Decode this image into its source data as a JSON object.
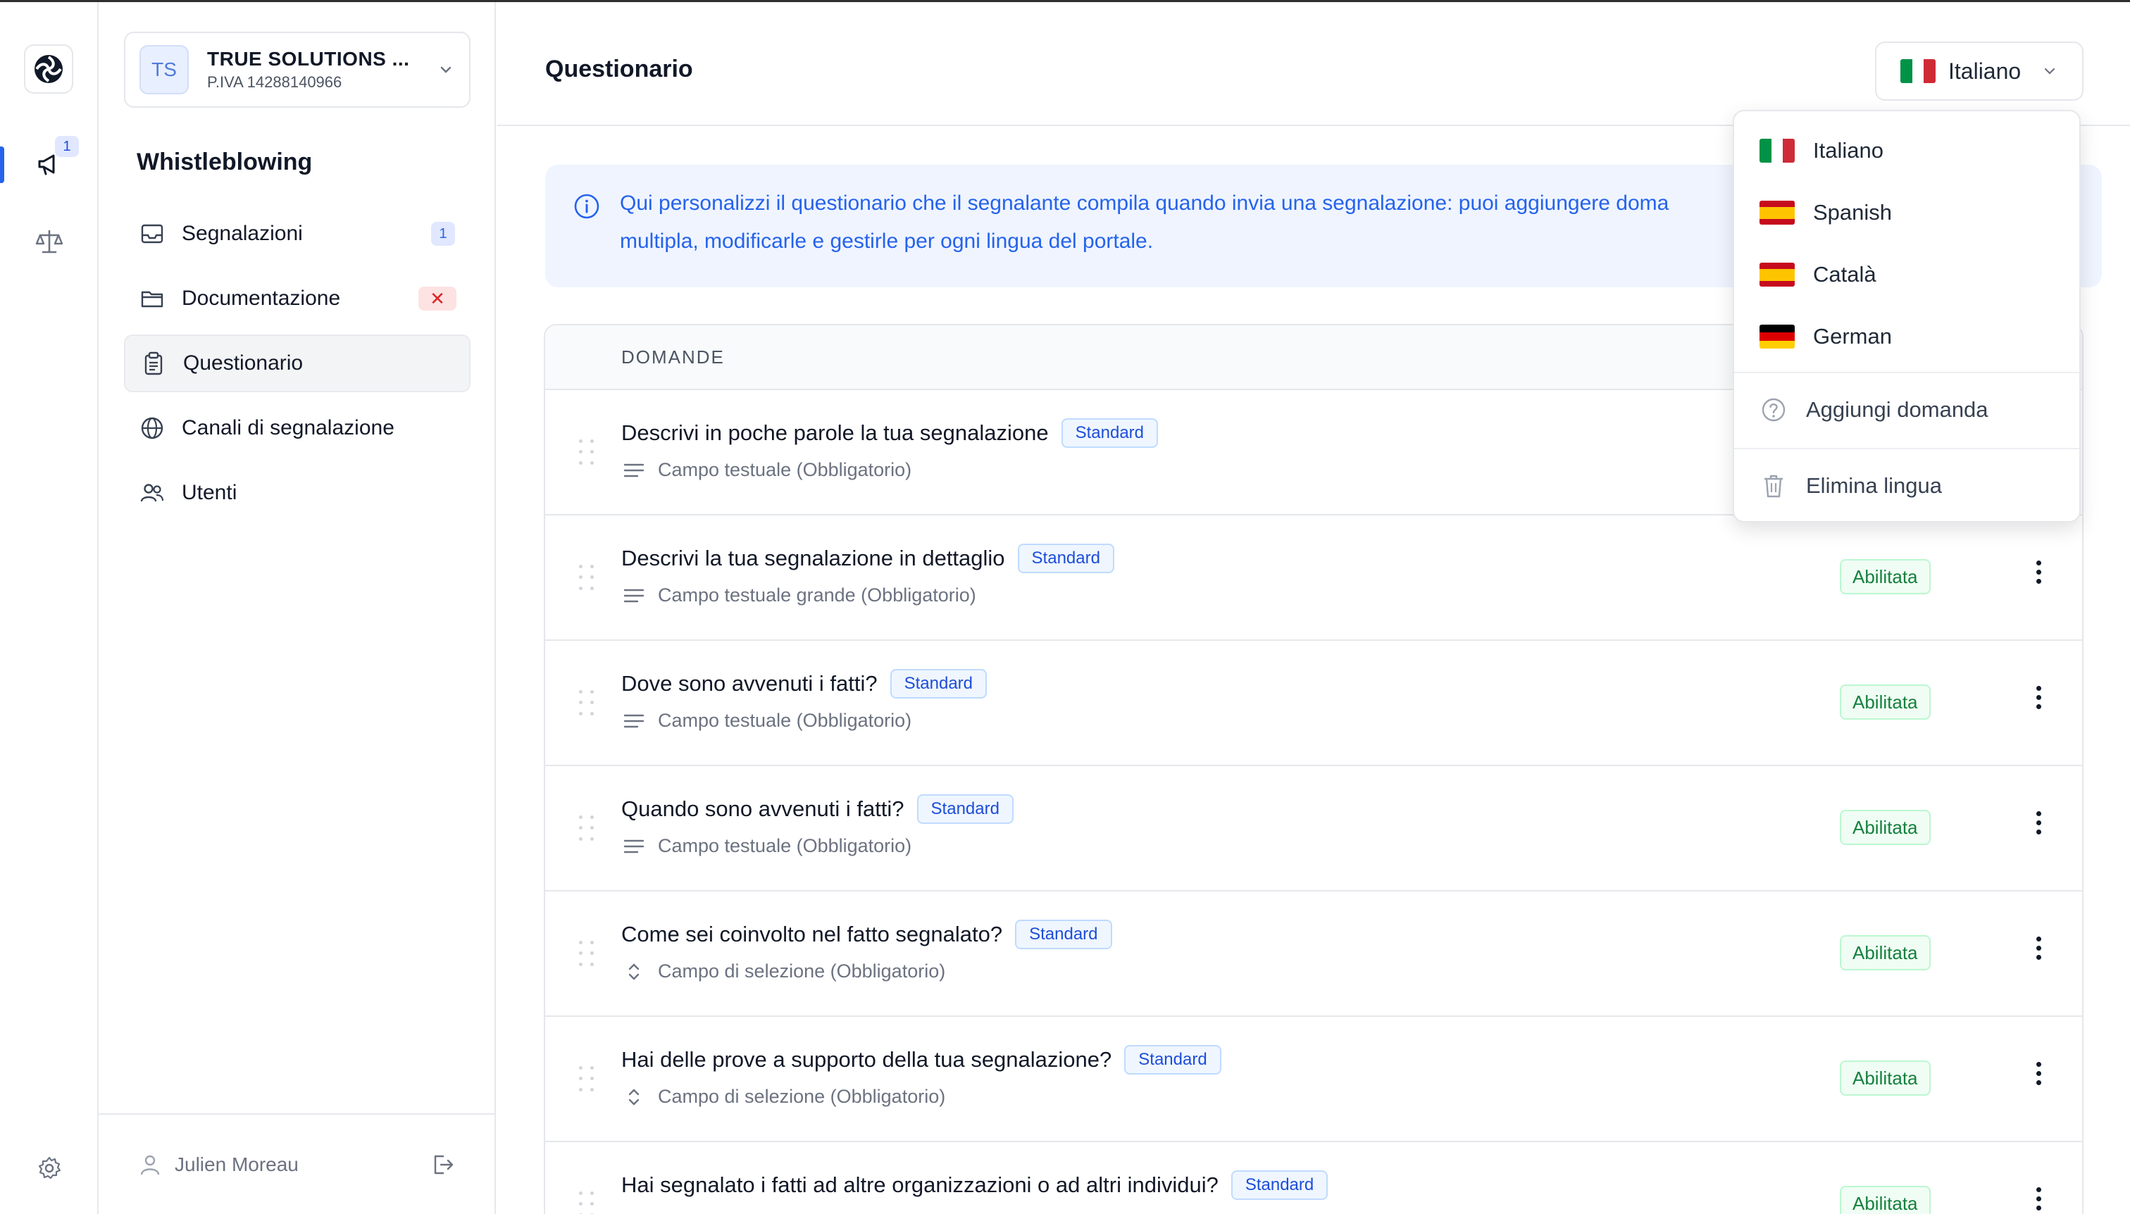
{
  "rail": {
    "badge": "1"
  },
  "org": {
    "initials": "TS",
    "name": "TRUE SOLUTIONS ...",
    "vat": "P.IVA 14288140966"
  },
  "sidebar": {
    "section_title": "Whistleblowing",
    "items": [
      {
        "label": "Segnalazioni",
        "icon": "inbox-icon",
        "badge": "1"
      },
      {
        "label": "Documentazione",
        "icon": "folder-icon",
        "badge": "✕"
      },
      {
        "label": "Questionario",
        "icon": "clipboard-icon",
        "active": true
      },
      {
        "label": "Canali di segnalazione",
        "icon": "globe-icon"
      },
      {
        "label": "Utenti",
        "icon": "users-icon"
      }
    ],
    "user": "Julien Moreau"
  },
  "header": {
    "title": "Questionario",
    "language": "Italiano"
  },
  "info": {
    "text": "Qui personalizzi il questionario che il segnalante compila quando invia una segnalazione: puoi aggiungere doma",
    "text2": "multipla, modificarle e gestirle per ogni lingua del portale."
  },
  "table": {
    "header": "DOMANDE",
    "rows": [
      {
        "title": "Descrivi in poche parole la tua segnalazione",
        "tag": "Standard",
        "type": "Campo testuale (Obbligatorio)",
        "type_icon": "lines-icon",
        "status": ""
      },
      {
        "title": "Descrivi la tua segnalazione in dettaglio",
        "tag": "Standard",
        "type": "Campo testuale grande (Obbligatorio)",
        "type_icon": "lines-icon",
        "status": "Abilitata"
      },
      {
        "title": "Dove sono avvenuti i fatti?",
        "tag": "Standard",
        "type": "Campo testuale (Obbligatorio)",
        "type_icon": "lines-icon",
        "status": "Abilitata"
      },
      {
        "title": "Quando sono avvenuti i fatti?",
        "tag": "Standard",
        "type": "Campo testuale (Obbligatorio)",
        "type_icon": "lines-icon",
        "status": "Abilitata"
      },
      {
        "title": "Come sei coinvolto nel fatto segnalato?",
        "tag": "Standard",
        "type": "Campo di selezione (Obbligatorio)",
        "type_icon": "chevron-updown-icon",
        "status": "Abilitata"
      },
      {
        "title": "Hai delle prove a supporto della tua segnalazione?",
        "tag": "Standard",
        "type": "Campo di selezione (Obbligatorio)",
        "type_icon": "chevron-updown-icon",
        "status": "Abilitata"
      },
      {
        "title": "Hai segnalato i fatti ad altre organizzazioni o ad altri individui?",
        "tag": "Standard",
        "type": "",
        "type_icon": "",
        "status": "Abilitata"
      }
    ]
  },
  "dropdown": {
    "languages": [
      {
        "label": "Italiano",
        "flag": [
          "#009246",
          "#ffffff",
          "#ce2b37"
        ]
      },
      {
        "label": "Spanish",
        "flag": [
          "#c60b1e",
          "#ffc400",
          "#c60b1e"
        ]
      },
      {
        "label": "Català",
        "flag": [
          "#c60b1e",
          "#ffc400",
          "#c60b1e"
        ]
      },
      {
        "label": "German",
        "flag": [
          "#000000",
          "#dd0000",
          "#ffce00"
        ]
      }
    ],
    "add_question": "Aggiungi domanda",
    "delete_language": "Elimina lingua"
  },
  "colors": {
    "accent": "#2563eb",
    "success": "#15803d",
    "danger": "#dc2626"
  }
}
